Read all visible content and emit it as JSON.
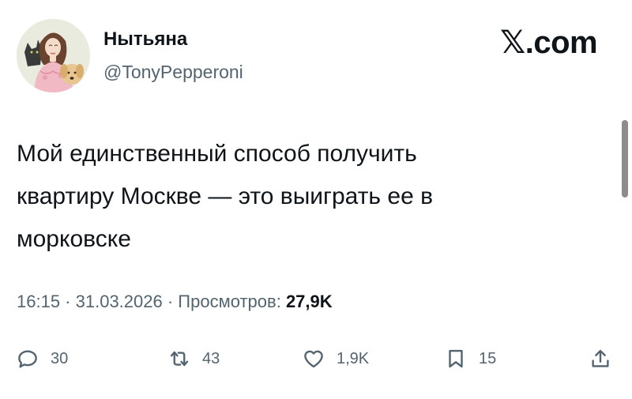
{
  "author": {
    "display_name": "Нытьяна",
    "handle": "@TonyPepperoni"
  },
  "brand": "𝕏.com",
  "tweet": {
    "text_lines": [
      "Мой единственный способ получить",
      "квартиру Москве — это выиграть ее в",
      "морковске"
    ]
  },
  "meta": {
    "time": "16:15",
    "separator": " · ",
    "date": "31.03.2026",
    "views_label": "Просмотров:",
    "views_count": "27,9K"
  },
  "actions": {
    "replies": "30",
    "reposts": "43",
    "likes": "1,9K",
    "bookmarks": "15"
  },
  "icons": [
    "reply-icon",
    "repost-icon",
    "like-icon",
    "bookmark-icon",
    "share-icon"
  ]
}
